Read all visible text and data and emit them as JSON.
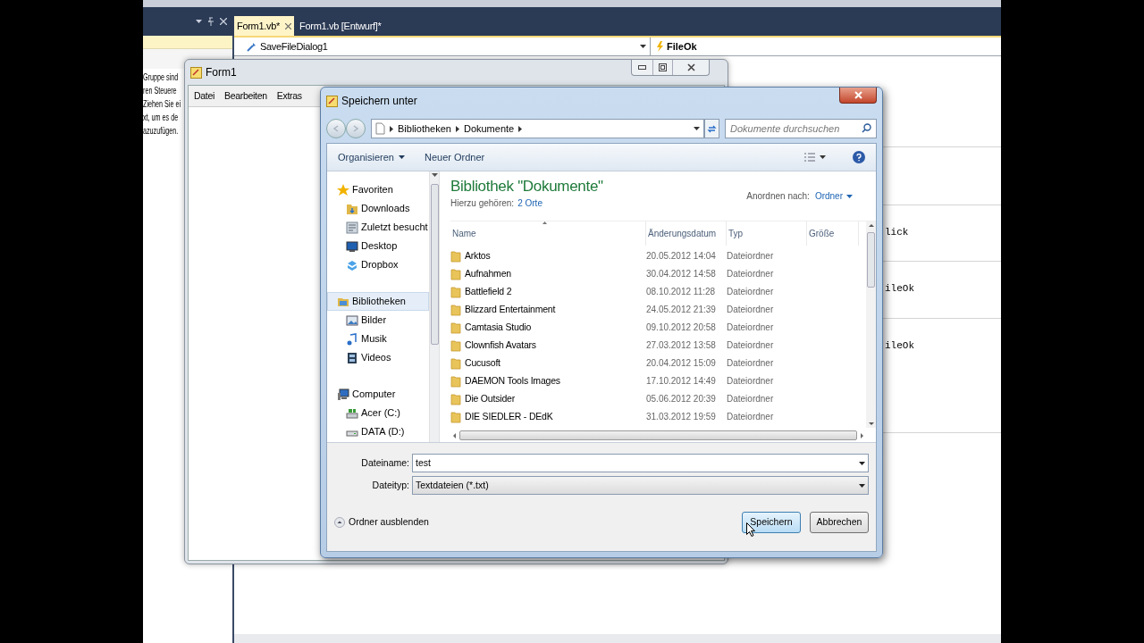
{
  "ide": {
    "tabs": [
      {
        "label": "Form1.vb*",
        "selected": true
      },
      {
        "label": "Form1.vb [Entwurf]*",
        "selected": false
      }
    ],
    "object_combo": "SaveFileDialog1",
    "event_combo": "FileOk",
    "toolbox_text": [
      "Gruppe sind",
      "ren Steuere",
      "Ziehen Sie ei",
      "xt, um es de",
      "azuzufügen."
    ],
    "code_fragments": [
      "lick",
      "ileOk",
      "ileOk"
    ]
  },
  "form1": {
    "title": "Form1",
    "menu": [
      "Datei",
      "Bearbeiten",
      "Extras"
    ]
  },
  "dialog": {
    "title": "Speichern unter",
    "breadcrumb": [
      "Bibliotheken",
      "Dokumente"
    ],
    "search": {
      "placeholder": "Dokumente durchsuchen"
    },
    "toolbar": [
      "Organisieren",
      "Neuer Ordner"
    ],
    "nav": [
      {
        "label": "Favoriten",
        "selected": false,
        "children": [
          {
            "label": "Downloads",
            "selected": false
          },
          {
            "label": "Zuletzt besucht",
            "selected": false
          },
          {
            "label": "Desktop",
            "selected": false
          },
          {
            "label": "Dropbox",
            "selected": false
          }
        ]
      },
      {
        "label": "Bibliotheken",
        "selected": true,
        "children": [
          {
            "label": "Bilder",
            "selected": false
          },
          {
            "label": "Musik",
            "selected": false
          },
          {
            "label": "Videos",
            "selected": false
          }
        ]
      },
      {
        "label": "Computer",
        "selected": false,
        "children": [
          {
            "label": "Acer (C:)",
            "selected": false
          },
          {
            "label": "DATA (D:)",
            "selected": false
          }
        ]
      }
    ],
    "library_title": "Bibliothek \"Dokumente\"",
    "includes_label": "Hierzu gehören:",
    "includes_link": "2 Orte",
    "arrange_label": "Anordnen nach:",
    "arrange_value": "Ordner",
    "columns": [
      "Name",
      "Änderungsdatum",
      "Typ",
      "Größe"
    ],
    "rows": [
      {
        "name": "Arktos",
        "date": "20.05.2012 14:04",
        "type": "Dateiordner"
      },
      {
        "name": "Aufnahmen",
        "date": "30.04.2012 14:58",
        "type": "Dateiordner"
      },
      {
        "name": "Battlefield 2",
        "date": "08.10.2012 11:28",
        "type": "Dateiordner"
      },
      {
        "name": "Blizzard Entertainment",
        "date": "24.05.2012 21:39",
        "type": "Dateiordner"
      },
      {
        "name": "Camtasia Studio",
        "date": "09.10.2012 20:58",
        "type": "Dateiordner"
      },
      {
        "name": "Clownfish Avatars",
        "date": "27.03.2012 13:58",
        "type": "Dateiordner"
      },
      {
        "name": "Cucusoft",
        "date": "20.04.2012 15:09",
        "type": "Dateiordner"
      },
      {
        "name": "DAEMON Tools Images",
        "date": "17.10.2012 14:49",
        "type": "Dateiordner"
      },
      {
        "name": "Die Outsider",
        "date": "05.06.2012 20:39",
        "type": "Dateiordner"
      },
      {
        "name": "DIE SIEDLER - DEdK",
        "date": "31.03.2012 19:59",
        "type": "Dateiordner"
      }
    ],
    "filename": {
      "label": "Dateiname:",
      "value": "test"
    },
    "filetype": {
      "label": "Dateityp:",
      "value": "Textdateien (*.txt)"
    },
    "hide_folders": "Ordner ausblenden",
    "buttons": [
      {
        "label": "Speichern",
        "kind": "default"
      },
      {
        "label": "Abbrechen",
        "kind": "normal"
      }
    ]
  }
}
